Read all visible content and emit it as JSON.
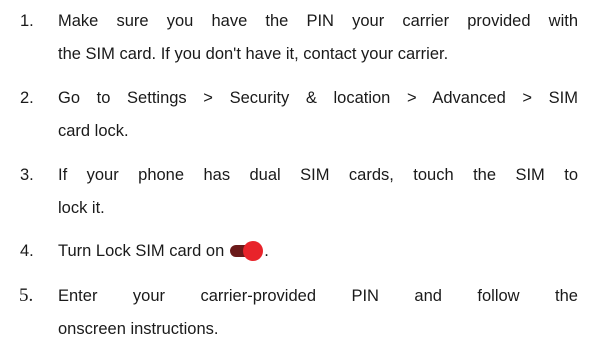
{
  "steps": [
    {
      "number": "1.",
      "lines": [
        "Make sure you have the PIN your carrier provided with",
        "the SIM card. If you don't have it, contact your carrier."
      ]
    },
    {
      "number": "2.",
      "lines": [
        "Go to Settings > Security & location > Advanced > SIM",
        "card lock."
      ]
    },
    {
      "number": "3.",
      "lines": [
        "If your phone has dual SIM cards, touch the SIM to",
        "lock it."
      ]
    },
    {
      "number": "4.",
      "text_before": "Turn Lock SIM card on",
      "text_after": "."
    },
    {
      "number": "5.",
      "lines": [
        "Enter your carrier-provided PIN and follow the",
        "onscreen instructions."
      ]
    }
  ],
  "toggle": {
    "state": "on",
    "track_color": "#6b1a1a",
    "thumb_color": "#e8232a"
  }
}
